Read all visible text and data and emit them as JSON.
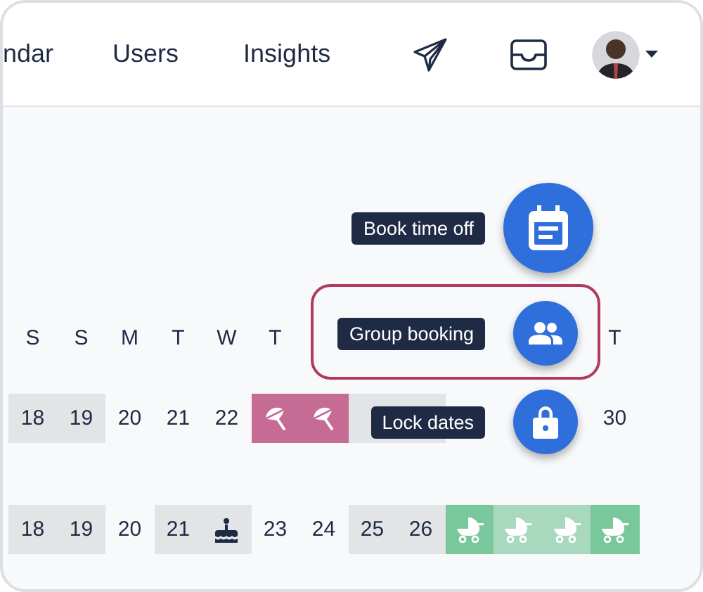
{
  "nav": {
    "items": [
      {
        "label": "ndar",
        "selected": false
      },
      {
        "label": "Users",
        "selected": false
      },
      {
        "label": "Insights",
        "selected": false
      }
    ]
  },
  "calendar": {
    "weekdays": [
      {
        "kind": "label",
        "text": "S"
      },
      {
        "kind": "label",
        "text": "S"
      },
      {
        "kind": "label",
        "text": "M"
      },
      {
        "kind": "label",
        "text": "T"
      },
      {
        "kind": "label",
        "text": "W"
      },
      {
        "kind": "label",
        "text": "T"
      },
      {
        "kind": "blank"
      },
      {
        "kind": "blank"
      },
      {
        "kind": "blank"
      },
      {
        "kind": "blank"
      },
      {
        "kind": "blank"
      },
      {
        "kind": "blank"
      },
      {
        "kind": "label",
        "text": "T"
      }
    ],
    "rows": [
      [
        {
          "kind": "off",
          "text": "18"
        },
        {
          "kind": "off",
          "text": "19"
        },
        {
          "kind": "day",
          "text": "20"
        },
        {
          "kind": "day",
          "text": "21"
        },
        {
          "kind": "day",
          "text": "22"
        },
        {
          "kind": "holiday",
          "color": "#c56b94"
        },
        {
          "kind": "holiday",
          "color": "#c56b94"
        },
        {
          "kind": "off"
        },
        {
          "kind": "off"
        },
        {
          "kind": "blank"
        },
        {
          "kind": "blank"
        },
        {
          "kind": "blank"
        },
        {
          "kind": "day",
          "text": "30"
        }
      ],
      [
        {
          "kind": "off",
          "text": "18"
        },
        {
          "kind": "off",
          "text": "19"
        },
        {
          "kind": "day",
          "text": "20"
        },
        {
          "kind": "off",
          "text": "21"
        },
        {
          "kind": "birthday"
        },
        {
          "kind": "day",
          "text": "23"
        },
        {
          "kind": "day",
          "text": "24"
        },
        {
          "kind": "off",
          "text": "25"
        },
        {
          "kind": "off",
          "text": "26"
        },
        {
          "kind": "parental",
          "color": "#78c89c"
        },
        {
          "kind": "parental",
          "color": "#a8d8bd"
        },
        {
          "kind": "parental",
          "color": "#a8d8bd"
        },
        {
          "kind": "parental",
          "color": "#78c89c"
        }
      ]
    ]
  },
  "actions": [
    {
      "kind": "book",
      "label": "Book time off",
      "highlighted": false
    },
    {
      "kind": "group",
      "label": "Group booking",
      "highlighted": true
    },
    {
      "kind": "lock",
      "label": "Lock dates",
      "highlighted": false
    }
  ]
}
